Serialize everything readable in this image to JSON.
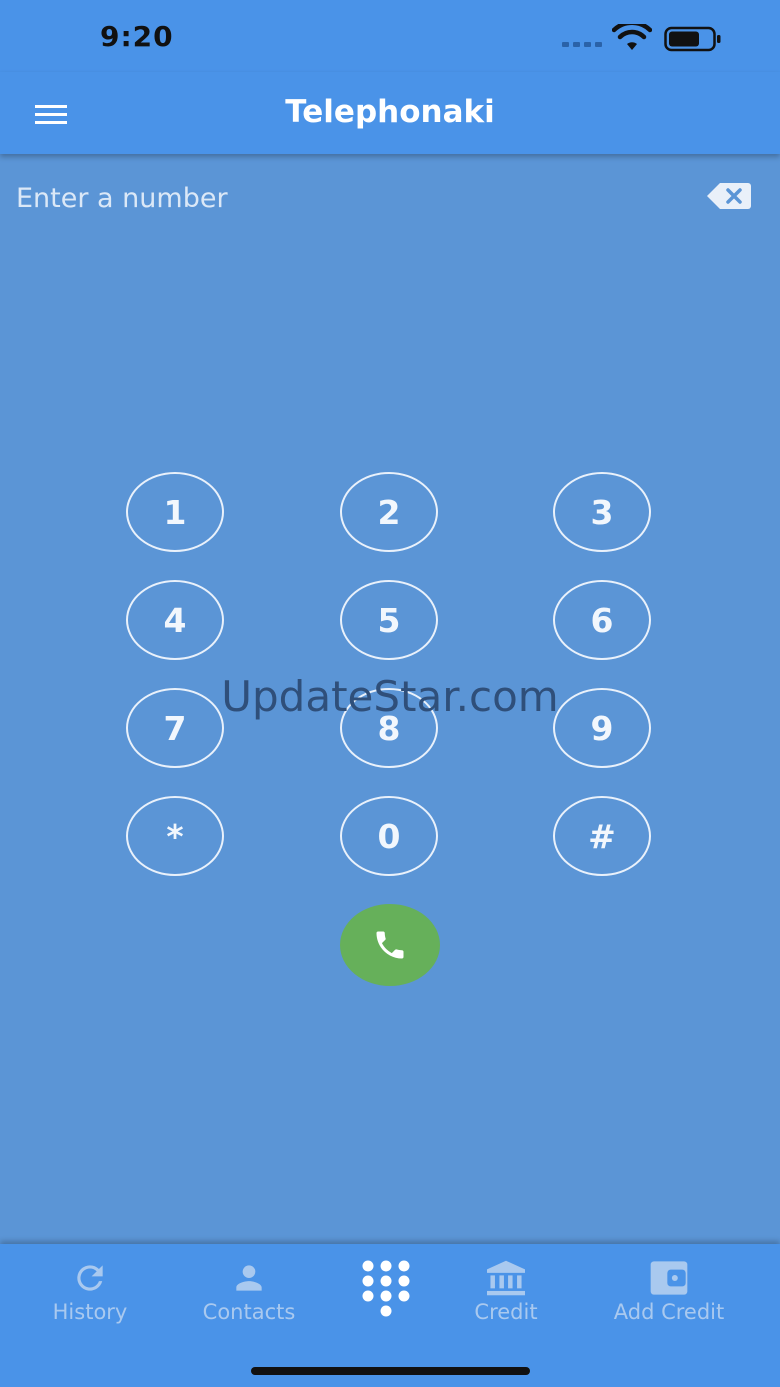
{
  "status_bar": {
    "time": "9:20"
  },
  "app_bar": {
    "title": "Telephonaki"
  },
  "dialer": {
    "input_placeholder": "Enter a number",
    "input_value": "",
    "keys": [
      "1",
      "2",
      "3",
      "4",
      "5",
      "6",
      "7",
      "8",
      "9",
      "*",
      "0",
      "#"
    ]
  },
  "watermark": "UpdateStar.com",
  "bottom_nav": {
    "items": [
      {
        "label": "History",
        "icon": "refresh-icon"
      },
      {
        "label": "Contacts",
        "icon": "person-icon"
      },
      {
        "label": "",
        "icon": "dialpad-icon",
        "active": true
      },
      {
        "label": "Credit",
        "icon": "bank-icon"
      },
      {
        "label": "Add Credit",
        "icon": "wallet-icon"
      }
    ]
  },
  "colors": {
    "bar": "#4a93e8",
    "background": "#5b95d6",
    "call": "#66b05a",
    "inactive_nav": "#a9c9ef"
  }
}
